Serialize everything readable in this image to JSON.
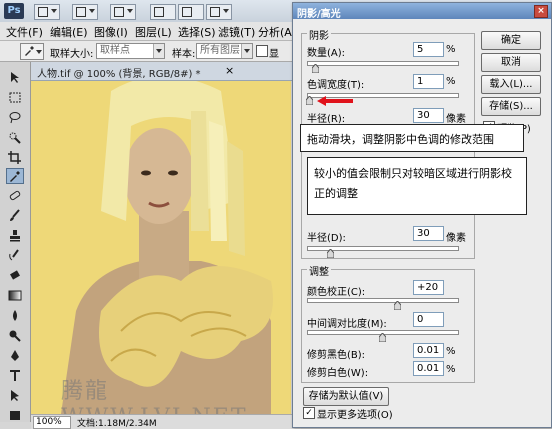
{
  "app": {
    "logo_text": "Ps"
  },
  "menu": [
    "文件(F)",
    "编辑(E)",
    "图像(I)",
    "图层(L)",
    "选择(S)",
    "滤镜(T)",
    "分析(A)"
  ],
  "options": {
    "sample_size_label": "取样大小:",
    "sample_size_value": "取样点",
    "sample_label": "样本:",
    "sample_value": "所有图层",
    "extra_checkbox": "显"
  },
  "document": {
    "tab_title": "人物.tif @ 100% (背景, RGB/8#) *",
    "close": "×",
    "zoom": "100%",
    "status": "文档:1.18M/2.34M"
  },
  "dialog": {
    "title": "阴影/高光",
    "close": "×",
    "shadows": {
      "title": "阴影",
      "amount_label": "数量(A):",
      "amount_value": "5",
      "amount_unit": "%",
      "amount_pos": 0.05,
      "tonal_label": "色调宽度(T):",
      "tonal_value": "1",
      "tonal_unit": "%",
      "tonal_pos": 0.01,
      "radius_label": "半径(R):",
      "radius_value": "30",
      "radius_unit": "像素"
    },
    "highlights": {
      "radius_label": "半径(D):",
      "radius_value": "30",
      "radius_unit": "像素"
    },
    "adjust": {
      "title": "调整",
      "color_label": "颜色校正(C):",
      "color_value": "+20",
      "color_pos": 0.6,
      "midtone_label": "中间调对比度(M):",
      "midtone_value": "0",
      "midtone_pos": 0.5,
      "black_label": "修剪黑色(B):",
      "black_value": "0.01",
      "black_unit": "%",
      "white_label": "修剪白色(W):",
      "white_value": "0.01",
      "white_unit": "%"
    },
    "save_default": "存储为默认值(V)",
    "show_more": "显示更多选项(O)",
    "buttons": {
      "ok": "确定",
      "cancel": "取消",
      "load": "载入(L)...",
      "save": "存储(S)...",
      "preview": "预览(P)"
    }
  },
  "callouts": {
    "one": "拖动滑块，调整阴影中色调的修改范围",
    "two": "较小的值会限制只对较暗区域进行阴影校正的调整"
  },
  "watermark": "腾龍 WWW.LVI.NET",
  "colors": {
    "accent_red": "#e0121b",
    "canvas_bg": "#eed878"
  }
}
